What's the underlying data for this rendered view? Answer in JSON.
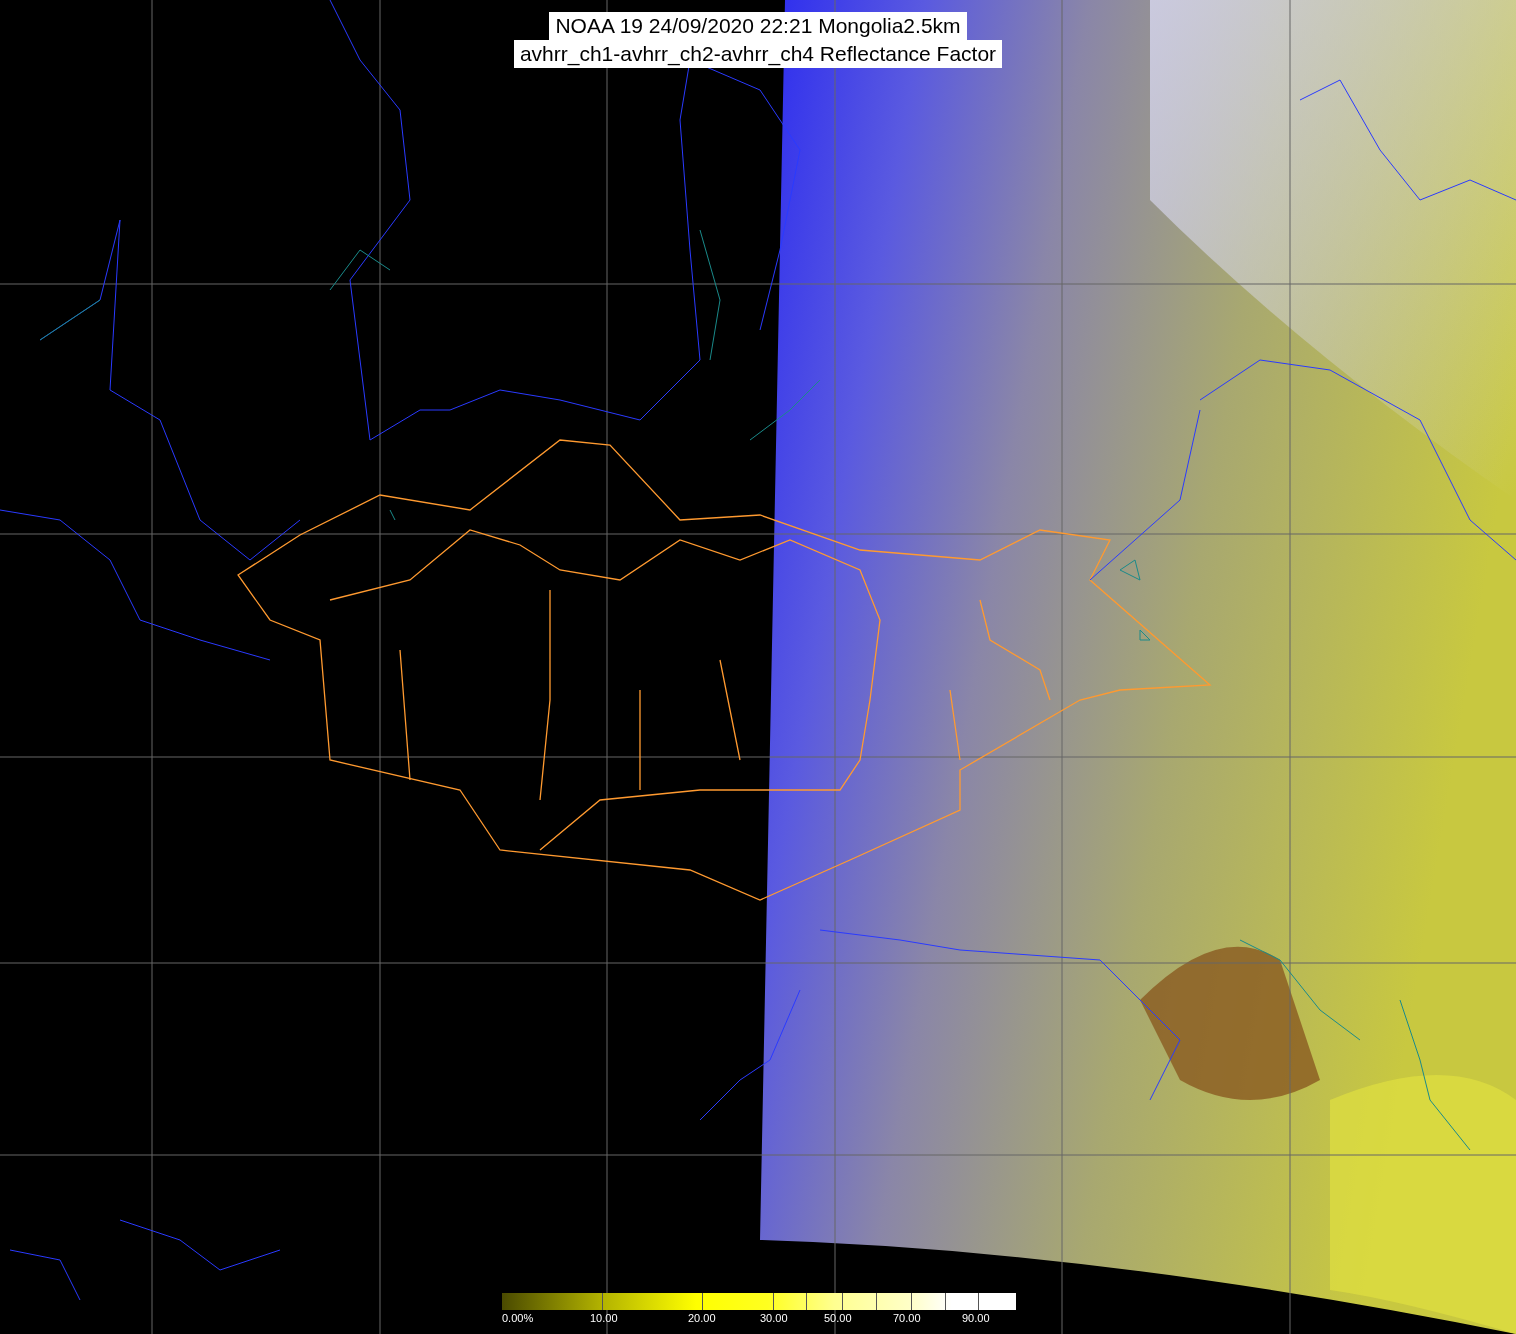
{
  "title": {
    "lines": [
      "NOAA 19 24/09/2020 22:21 Mongolia2.5km",
      "avhrr_ch1-avhrr_ch2-avhrr_ch4 Reflectance Factor"
    ]
  },
  "colorbar": {
    "labels": [
      "0.00%",
      "10.00",
      "20.00",
      "30.00",
      "50.00",
      "70.00",
      "90.00"
    ]
  }
}
